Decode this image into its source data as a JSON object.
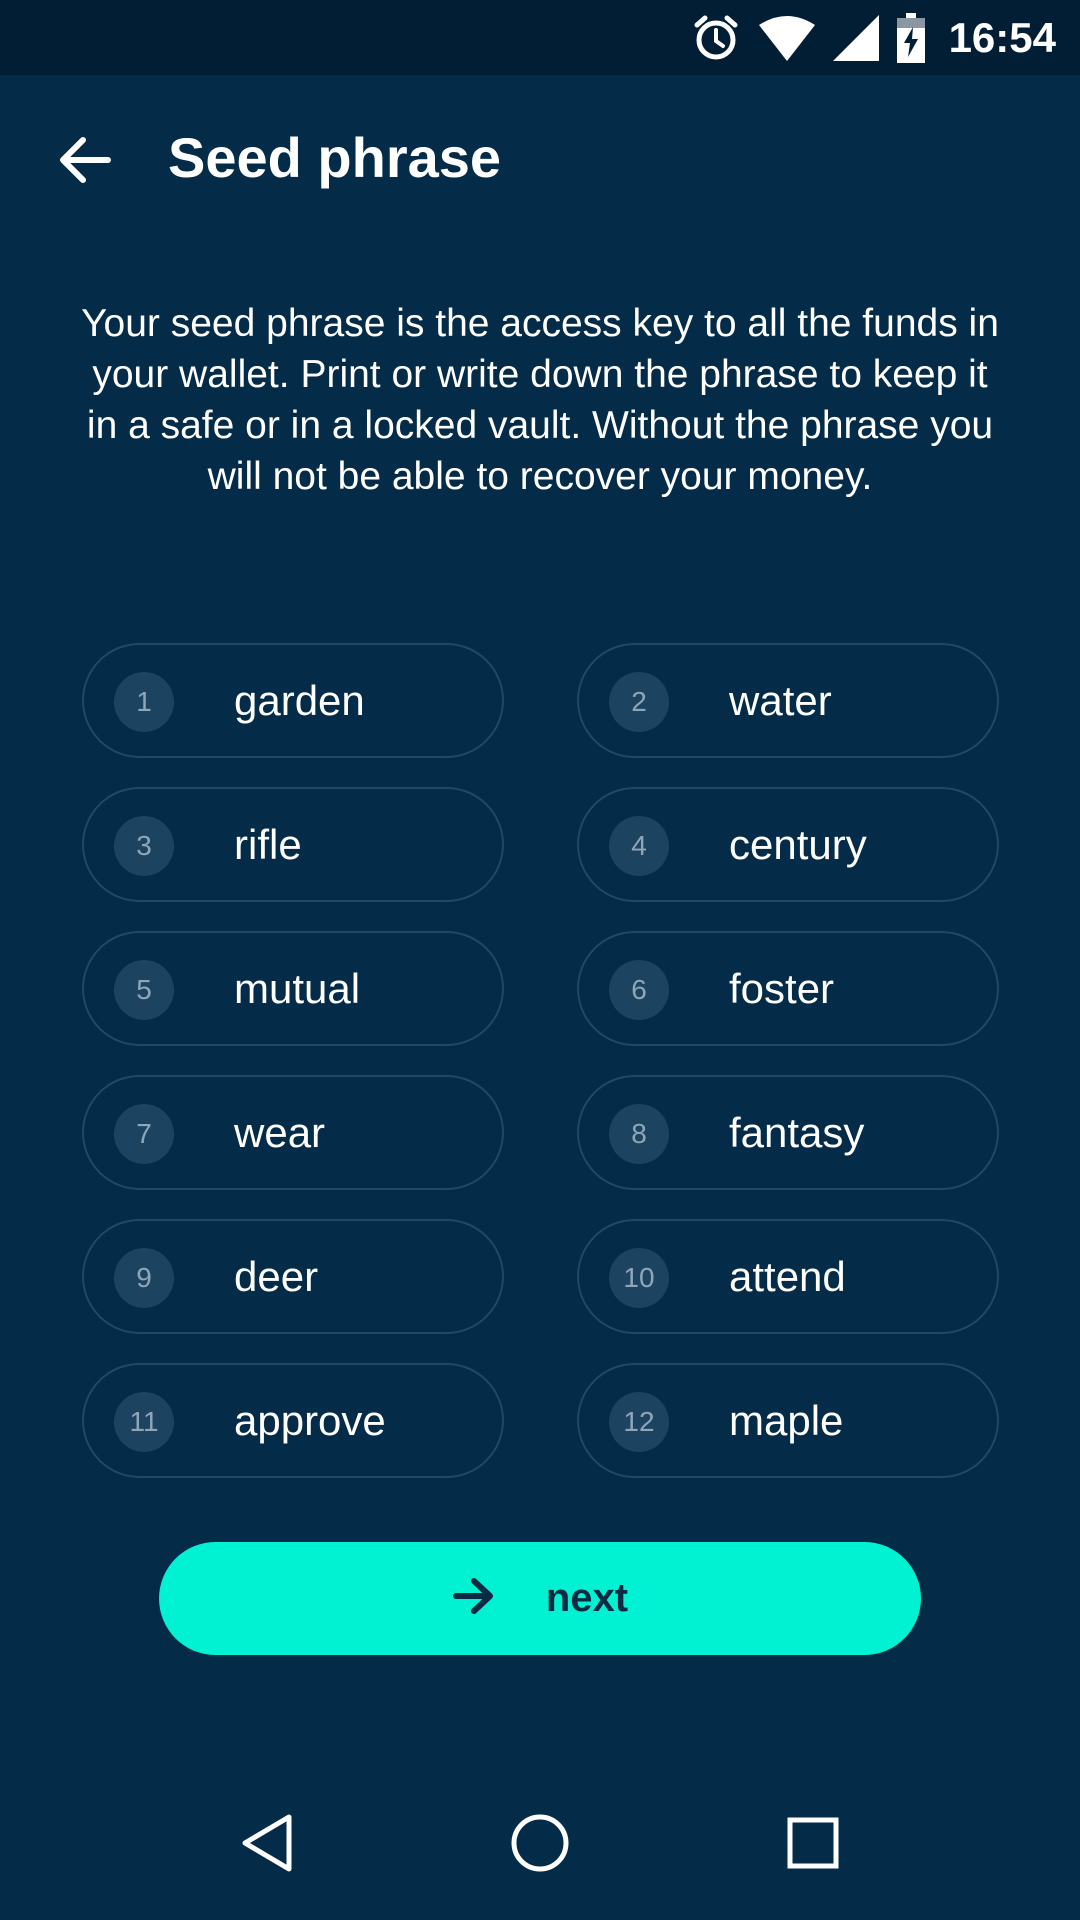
{
  "status_bar": {
    "time": "16:54",
    "icons": [
      "alarm-icon",
      "wifi-icon",
      "signal-icon",
      "battery-charging-icon"
    ]
  },
  "header": {
    "title": "Seed phrase",
    "back_icon": "arrow-left-icon"
  },
  "description": "Your seed phrase is the access key to all the funds in your wallet. Print or write down the phrase to keep it in a safe or in a locked vault. Without the phrase you will not be able to recover your money.",
  "words": [
    {
      "num": "1",
      "word": "garden"
    },
    {
      "num": "2",
      "word": "water"
    },
    {
      "num": "3",
      "word": "rifle"
    },
    {
      "num": "4",
      "word": "century"
    },
    {
      "num": "5",
      "word": "mutual"
    },
    {
      "num": "6",
      "word": "foster"
    },
    {
      "num": "7",
      "word": "wear"
    },
    {
      "num": "8",
      "word": "fantasy"
    },
    {
      "num": "9",
      "word": "deer"
    },
    {
      "num": "10",
      "word": "attend"
    },
    {
      "num": "11",
      "word": "approve"
    },
    {
      "num": "12",
      "word": "maple"
    }
  ],
  "next_button": {
    "label": "next",
    "icon": "arrow-right-icon"
  },
  "nav_bar": {
    "icons": [
      "back-triangle-icon",
      "home-circle-icon",
      "recents-square-icon"
    ]
  },
  "colors": {
    "background": "#042b48",
    "status_bar": "#021e35",
    "accent": "#00f2d2",
    "pill_border": "#1e4a68"
  }
}
